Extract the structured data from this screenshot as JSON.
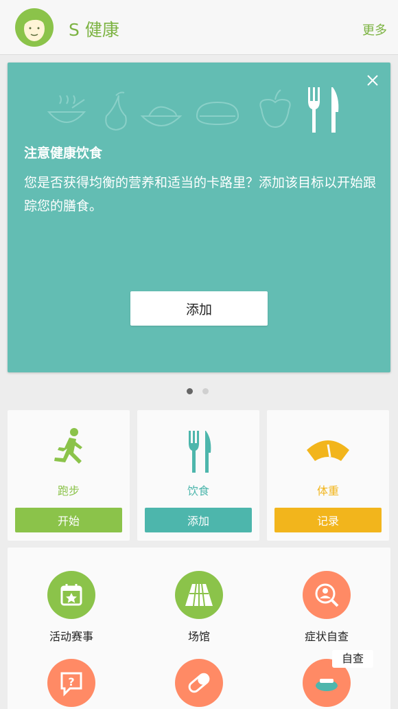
{
  "header": {
    "app_title": "S 健康",
    "more_label": "更多"
  },
  "promo": {
    "title": "注意健康饮食",
    "body": "您是否获得均衡的营养和适当的卡路里？添加该目标以开始跟踪您的膳食。",
    "add_label": "添加",
    "page_count": 2,
    "current_page": 1
  },
  "tiles": [
    {
      "label": "跑步",
      "button": "开始",
      "color": "#8bc34a",
      "icon": "running-icon"
    },
    {
      "label": "饮食",
      "button": "添加",
      "color": "#4db6ac",
      "icon": "fork-knife-icon"
    },
    {
      "label": "体重",
      "button": "记录",
      "color": "#f2b51c",
      "icon": "scale-icon"
    }
  ],
  "services": [
    {
      "label": "活动赛事",
      "color": "#8bc34a",
      "icon": "calendar-star-icon"
    },
    {
      "label": "场馆",
      "color": "#8bc34a",
      "icon": "stadium-track-icon"
    },
    {
      "label": "症状自查",
      "color": "#ff8a65",
      "icon": "person-search-icon"
    },
    {
      "label": "",
      "color": "#ff8a65",
      "icon": "question-bubble-icon"
    },
    {
      "label": "",
      "color": "#ff8a65",
      "icon": "pill-icon"
    },
    {
      "label": "",
      "color": "#ff8a65",
      "icon": "scale-tray-icon"
    }
  ],
  "floating_label": "自查"
}
